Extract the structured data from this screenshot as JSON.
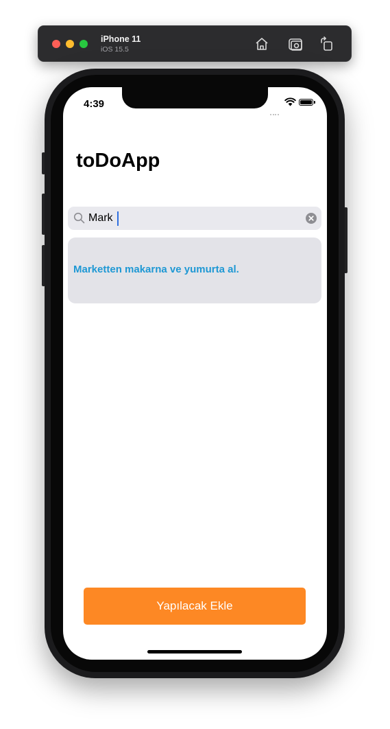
{
  "simulator": {
    "device_name": "iPhone 11",
    "os_version": "iOS 15.5",
    "icons": [
      "home-icon",
      "screenshot-icon",
      "rotate-icon"
    ]
  },
  "status_bar": {
    "time": "4:39"
  },
  "app": {
    "title": "toDoApp",
    "search": {
      "value": "Mark",
      "placeholder": ""
    },
    "todos": [
      {
        "text": "Marketten makarna ve yumurta al."
      }
    ],
    "add_button_label": "Yapılacak Ekle"
  },
  "colors": {
    "accent_orange": "#fd8824",
    "todo_text_blue": "#1e98d4",
    "card_background": "#e3e3e8"
  }
}
